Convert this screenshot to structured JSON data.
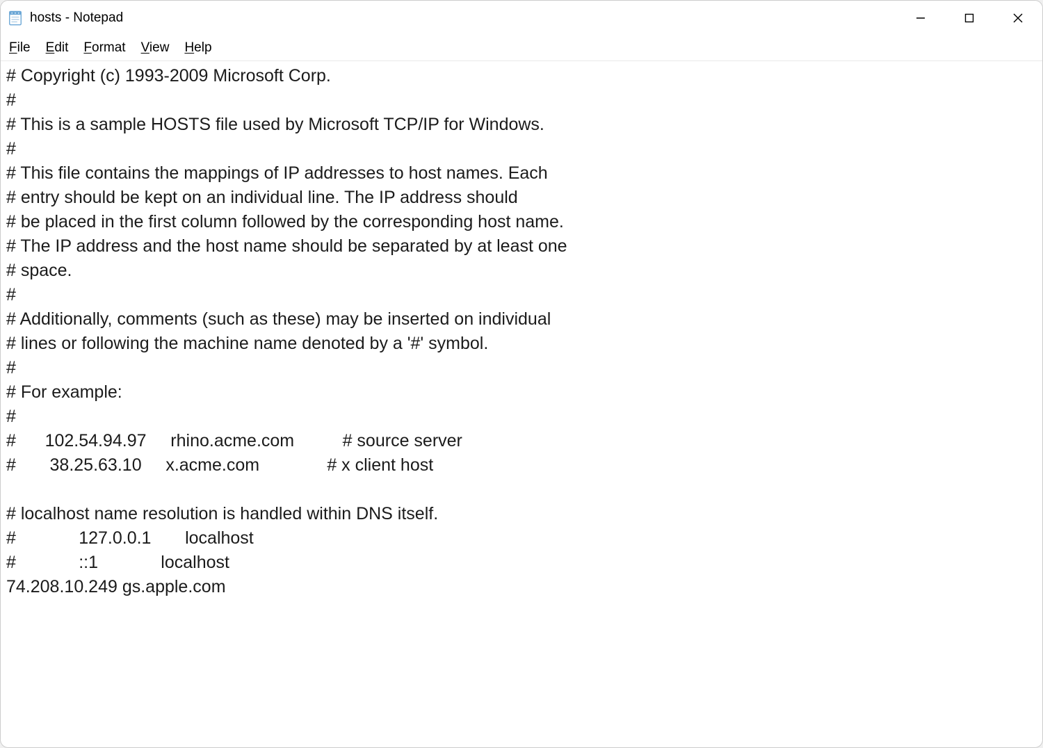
{
  "titlebar": {
    "title": "hosts - Notepad"
  },
  "menubar": {
    "items": [
      {
        "mnemonic": "F",
        "rest": "ile"
      },
      {
        "mnemonic": "E",
        "rest": "dit"
      },
      {
        "mnemonic": "F",
        "rest": "ormat"
      },
      {
        "mnemonic": "V",
        "rest": "iew"
      },
      {
        "mnemonic": "H",
        "rest": "elp"
      }
    ]
  },
  "editor": {
    "content": "# Copyright (c) 1993-2009 Microsoft Corp.\n#\n# This is a sample HOSTS file used by Microsoft TCP/IP for Windows.\n#\n# This file contains the mappings of IP addresses to host names. Each\n# entry should be kept on an individual line. The IP address should\n# be placed in the first column followed by the corresponding host name.\n# The IP address and the host name should be separated by at least one\n# space.\n#\n# Additionally, comments (such as these) may be inserted on individual\n# lines or following the machine name denoted by a '#' symbol.\n#\n# For example:\n#\n#      102.54.94.97     rhino.acme.com          # source server\n#       38.25.63.10     x.acme.com              # x client host\n\n# localhost name resolution is handled within DNS itself.\n#             127.0.0.1       localhost\n#             ::1             localhost\n74.208.10.249 gs.apple.com"
  }
}
